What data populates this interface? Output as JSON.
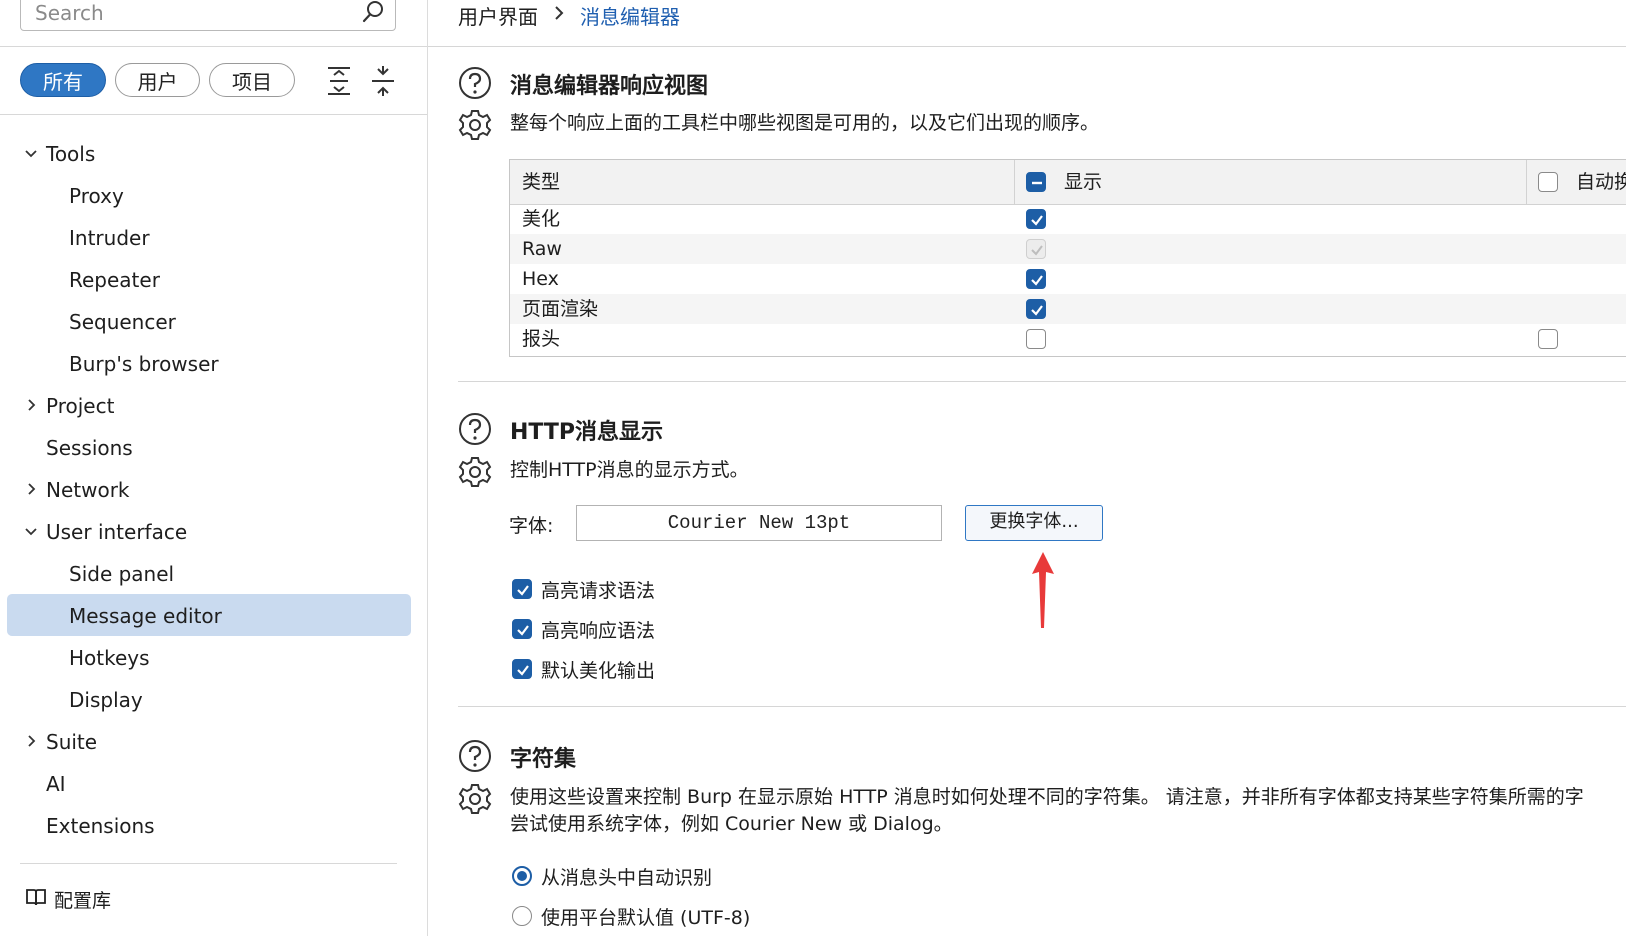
{
  "sidebar": {
    "search": {
      "placeholder": "Search",
      "value": ""
    },
    "filters": [
      "所有",
      "用户",
      "项目"
    ],
    "active_filter": "所有",
    "nav": {
      "tools": "Tools",
      "proxy": "Proxy",
      "intruder": "Intruder",
      "repeater": "Repeater",
      "sequencer": "Sequencer",
      "burps_browser": "Burp's browser",
      "project": "Project",
      "sessions": "Sessions",
      "network": "Network",
      "user_interface": "User interface",
      "side_panel": "Side panel",
      "message_editor": "Message editor",
      "hotkeys": "Hotkeys",
      "display": "Display",
      "suite": "Suite",
      "ai": "AI",
      "extensions": "Extensions"
    },
    "library_label": "配置库"
  },
  "breadcrumb": {
    "parent": "用户界面",
    "current": "消息编辑器"
  },
  "section_views": {
    "title": "消息编辑器响应视图",
    "description": "整每个响应上面的工具栏中哪些视图是可用的，以及它们出现的顺序。",
    "columns": {
      "type": "类型",
      "show": "显示",
      "auto": "自动换"
    },
    "rows": [
      {
        "type": "美化",
        "show": "checked",
        "auto": "none"
      },
      {
        "type": "Raw",
        "show": "disabled-checked",
        "auto": "none"
      },
      {
        "type": "Hex",
        "show": "checked",
        "auto": "none"
      },
      {
        "type": "页面渲染",
        "show": "checked",
        "auto": "none"
      },
      {
        "type": "报头",
        "show": "unchecked",
        "auto": "unchecked"
      }
    ]
  },
  "section_http": {
    "title": "HTTP消息显示",
    "description": "控制HTTP消息的显示方式。",
    "font_label": "字体:",
    "font_value": "Courier New 13pt",
    "change_font_button": "更换字体...",
    "options": [
      {
        "label": "高亮请求语法",
        "checked": true
      },
      {
        "label": "高亮响应语法",
        "checked": true
      },
      {
        "label": "默认美化输出",
        "checked": true
      }
    ]
  },
  "section_charset": {
    "title": "字符集",
    "description_line1": "使用这些设置来控制 Burp 在显示原始 HTTP 消息时如何处理不同的字符集。 请注意，并非所有字体都支持某些字符集所需的字",
    "description_line2": "尝试使用系统字体，例如 Courier New 或 Dialog。",
    "radios": [
      {
        "label": "从消息头中自动识别",
        "selected": true
      },
      {
        "label": "使用平台默认值 (UTF-8)",
        "selected": false
      }
    ]
  },
  "colors": {
    "accent": "#1d5ea6",
    "selected_row": "#c9daef",
    "arrow": "#e83a3a"
  }
}
